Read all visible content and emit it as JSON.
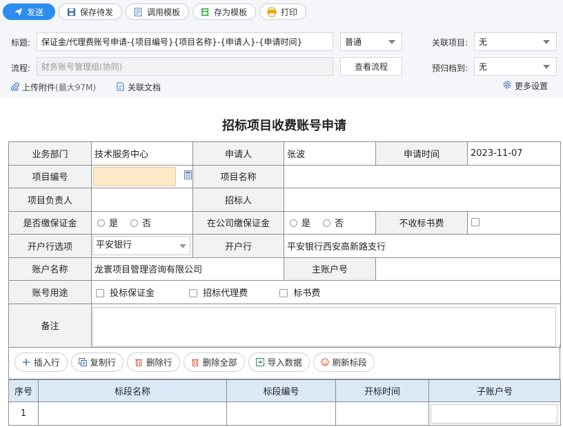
{
  "toolbar": {
    "send": "发送",
    "save_draft": "保存待发",
    "use_template": "调用模板",
    "save_template": "存为模板",
    "print": "打印"
  },
  "header": {
    "title_label": "标题:",
    "title_value": "保证金/代理费账号申请-{项目编号}{项目名称}-{申请人}-{申请时间}",
    "priority_value": "普通",
    "related_project_label": "关联项目:",
    "related_project_value": "无",
    "flow_label": "流程:",
    "flow_placeholder": "财务账号管理组(协同)",
    "view_flow": "查看流程",
    "archive_label": "预归档到:",
    "archive_value": "无",
    "upload": "上传附件",
    "upload_limit": "(最大97M)",
    "related_doc": "关联文档",
    "more_settings": "更多设置"
  },
  "form": {
    "title": "招标项目收费账号申请",
    "dept_label": "业务部门",
    "dept_value": "技术服务中心",
    "applicant_label": "申请人",
    "applicant_value": "张波",
    "apply_time_label": "申请时间",
    "apply_time_value": "2023-11-07",
    "project_no_label": "项目编号",
    "project_name_label": "项目名称",
    "project_lead_label": "项目负责人",
    "bidder_label": "招标人",
    "deposit_paid_label": "是否缴保证金",
    "yes": "是",
    "no": "否",
    "company_deposit_label": "在公司缴保证金",
    "no_fee_label": "不收标书费",
    "bank_option_label": "开户行选项",
    "bank_option_value": "平安银行",
    "bank_label": "开户行",
    "bank_value": "平安银行西安高新路支行",
    "account_name_label": "账户名称",
    "account_name_value": "龙寰项目管理咨询有限公司",
    "main_account_label": "主账户号",
    "usage_label": "账号用途",
    "usage_opt1": "投标保证金",
    "usage_opt2": "招标代理费",
    "usage_opt3": "标书费",
    "remark_label": "备注"
  },
  "grid_toolbar": {
    "insert": "插入行",
    "copy": "复制行",
    "delete": "删除行",
    "delete_all": "删除全部",
    "import": "导入数据",
    "refresh": "刷新标段"
  },
  "grid": {
    "columns": [
      "序号",
      "标段名称",
      "标段编号",
      "开标时间",
      "子账户号"
    ],
    "rows": [
      {
        "no": "1"
      }
    ]
  },
  "colors": {
    "accent": "#2d8cf0",
    "header_bg": "#dbe9f7",
    "required_field": "#fde9c7"
  }
}
